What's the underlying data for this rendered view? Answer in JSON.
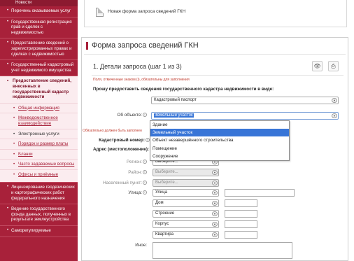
{
  "sidebar": {
    "top_label": "Новости",
    "items_before": [
      "Перечень оказываемых услуг",
      "Государственная регистрация прав и сделок с недвижимостью",
      "Предоставление сведений о зарегистрированных правах и сделках с недвижимостью",
      "Государственный кадастровый учет недвижимого имущества"
    ],
    "active_item": "Предоставление сведений, внесенных в государственный кадастр недвижимости",
    "sub_items": [
      "Общая информация",
      "Межведомственное взаимодействие",
      "Электронные услуги",
      "Порядок и размер платы",
      "Бланки",
      "Часто задаваемые вопросы",
      "Офисы и приёмные"
    ],
    "items_after": [
      "Лицензирование геодезических и картографических работ федерального назначения",
      "Ведение государственного фонда данных, полученных в результате землеустройства",
      "Саморегулируемые"
    ]
  },
  "top_card": {
    "label": "Новая форма запроса сведений ГКН"
  },
  "form": {
    "page_title": "Форма запроса сведений ГКН",
    "step_title": "1. Детали запроса (шаг 1 из 3)",
    "required_note": "Поля, отмеченные знаком (i), обязательны для заполнения",
    "prompt": "Прошу предоставить сведения государственного кадастра недвижимости в виде:",
    "doc_type_value": "Кадастровый паспорт",
    "object_label": "Об объекте:",
    "object_value": "Земельный участок",
    "object_options": [
      "Здание",
      "Земельный участок",
      "Объект незавершённого строительства",
      "Помещение",
      "Сооружение"
    ],
    "object_highlight_index": 1,
    "mandatory_note": "Обязательно должен быть заполнен",
    "cadastral_label": "Кадастровый номер:",
    "address_label": "Адрес (местоположение):",
    "region_label": "Регион:",
    "region_value": "Выберите...",
    "district_label": "Район:",
    "district_value": "Выберите...",
    "locality_label": "Населенный пункт:",
    "locality_value": "Выберите...",
    "street_label": "Улица:",
    "street_value": "Улица",
    "house_value": "Дом",
    "building_value": "Строение",
    "korpus_value": "Корпус",
    "apartment_value": "Квартира",
    "other_label": "Иное:"
  },
  "colors": {
    "accent": "#a8213a",
    "highlight": "#3875d7",
    "error": "#c0392b"
  }
}
